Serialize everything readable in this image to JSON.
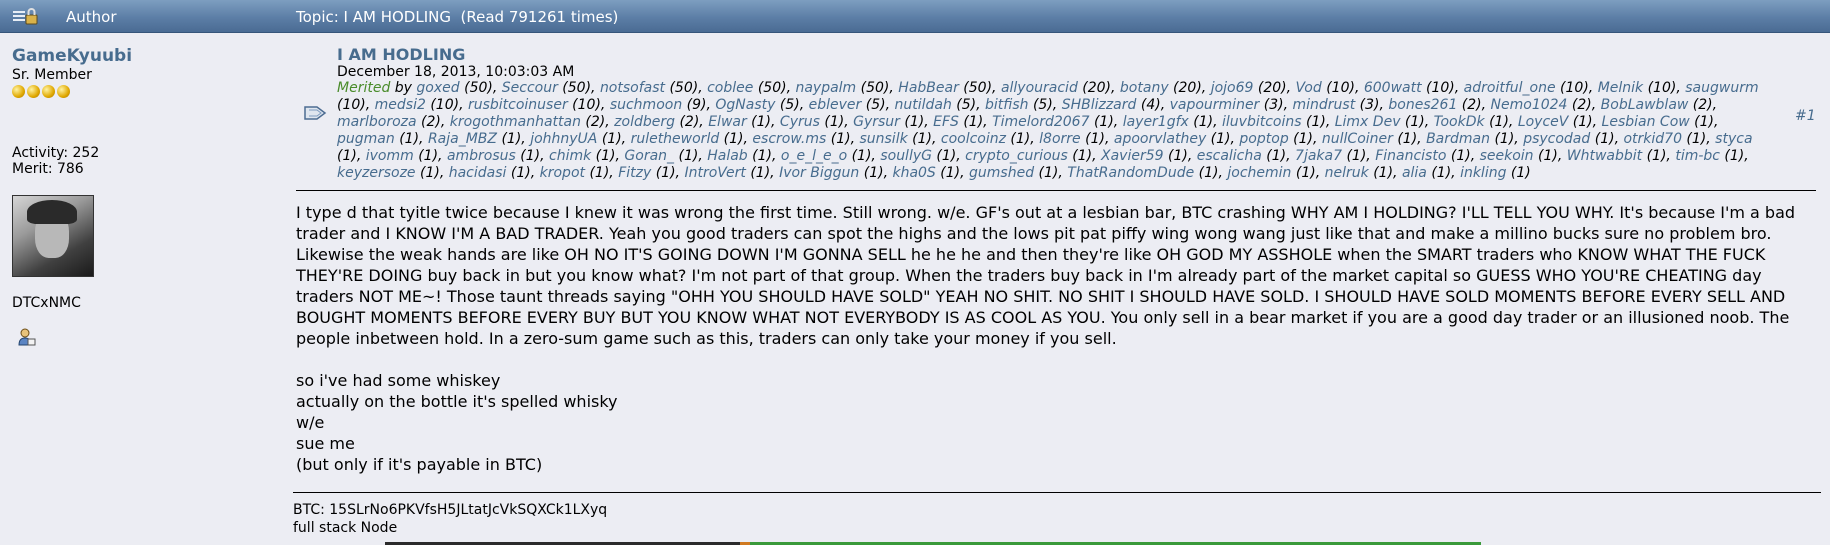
{
  "header": {
    "author_label": "Author",
    "topic_title": "Topic: I AM HODLING  (Read 791261 times)",
    "lock_icon": "lock-icon"
  },
  "poster": {
    "name": "GameKyuubi",
    "rank": "Sr. Member",
    "stars": 4,
    "activity": "Activity: 252",
    "merit": "Merit: 786",
    "sig_id": "DTCxNMC",
    "profile_icon": "profile-icon"
  },
  "post": {
    "subject": "I AM HODLING",
    "date": "December 18, 2013, 10:03:03 AM",
    "merited_label": "Merited",
    "by_label": " by ",
    "post_number": "#1",
    "merits": [
      {
        "user": "goxed",
        "count": "50"
      },
      {
        "user": "Seccour",
        "count": "50"
      },
      {
        "user": "notsofast",
        "count": "50"
      },
      {
        "user": "coblee",
        "count": "50"
      },
      {
        "user": "naypalm",
        "count": "50"
      },
      {
        "user": "HabBear",
        "count": "50"
      },
      {
        "user": "allyouracid",
        "count": "20"
      },
      {
        "user": "botany",
        "count": "20"
      },
      {
        "user": "jojo69",
        "count": "20"
      },
      {
        "user": "Vod",
        "count": "10"
      },
      {
        "user": "600watt",
        "count": "10"
      },
      {
        "user": "adroitful_one",
        "count": "10"
      },
      {
        "user": "Melnik",
        "count": "10"
      },
      {
        "user": "saugwurm",
        "count": "10"
      },
      {
        "user": "medsi2",
        "count": "10"
      },
      {
        "user": "rusbitcoinuser",
        "count": "10"
      },
      {
        "user": "suchmoon",
        "count": "9"
      },
      {
        "user": "OgNasty",
        "count": "5"
      },
      {
        "user": "eblever",
        "count": "5"
      },
      {
        "user": "nutildah",
        "count": "5"
      },
      {
        "user": "bitfish",
        "count": "5"
      },
      {
        "user": "SHBlizzard",
        "count": "4"
      },
      {
        "user": "vapourminer",
        "count": "3"
      },
      {
        "user": "mindrust",
        "count": "3"
      },
      {
        "user": "bones261",
        "count": "2"
      },
      {
        "user": "Nemo1024",
        "count": "2"
      },
      {
        "user": "BobLawblaw",
        "count": "2"
      },
      {
        "user": "marlboroza",
        "count": "2"
      },
      {
        "user": "krogothmanhattan",
        "count": "2"
      },
      {
        "user": "zoldberg",
        "count": "2"
      },
      {
        "user": "Elwar",
        "count": "1"
      },
      {
        "user": "Cyrus",
        "count": "1"
      },
      {
        "user": "Gyrsur",
        "count": "1"
      },
      {
        "user": "EFS",
        "count": "1"
      },
      {
        "user": "Timelord2067",
        "count": "1"
      },
      {
        "user": "layer1gfx",
        "count": "1"
      },
      {
        "user": "iluvbitcoins",
        "count": "1"
      },
      {
        "user": "Limx Dev",
        "count": "1"
      },
      {
        "user": "TookDk",
        "count": "1"
      },
      {
        "user": "LoyceV",
        "count": "1"
      },
      {
        "user": "Lesbian Cow",
        "count": "1"
      },
      {
        "user": "pugman",
        "count": "1"
      },
      {
        "user": "Raja_MBZ",
        "count": "1"
      },
      {
        "user": "johhnyUA",
        "count": "1"
      },
      {
        "user": "ruletheworld",
        "count": "1"
      },
      {
        "user": "escrow.ms",
        "count": "1"
      },
      {
        "user": "sunsilk",
        "count": "1"
      },
      {
        "user": "coolcoinz",
        "count": "1"
      },
      {
        "user": "l8orre",
        "count": "1"
      },
      {
        "user": "apoorvlathey",
        "count": "1"
      },
      {
        "user": "poptop",
        "count": "1"
      },
      {
        "user": "nullCoiner",
        "count": "1"
      },
      {
        "user": "Bardman",
        "count": "1"
      },
      {
        "user": "psycodad",
        "count": "1"
      },
      {
        "user": "otrkid70",
        "count": "1"
      },
      {
        "user": "styca",
        "count": "1"
      },
      {
        "user": "ivomm",
        "count": "1"
      },
      {
        "user": "ambrosus",
        "count": "1"
      },
      {
        "user": "chimk",
        "count": "1"
      },
      {
        "user": "Goran_",
        "count": "1"
      },
      {
        "user": "Halab",
        "count": "1"
      },
      {
        "user": "o_e_l_e_o",
        "count": "1"
      },
      {
        "user": "soullyG",
        "count": "1"
      },
      {
        "user": "crypto_curious",
        "count": "1"
      },
      {
        "user": "Xavier59",
        "count": "1"
      },
      {
        "user": "escalicha",
        "count": "1"
      },
      {
        "user": "7jaka7",
        "count": "1"
      },
      {
        "user": "Financisto",
        "count": "1"
      },
      {
        "user": "seekoin",
        "count": "1"
      },
      {
        "user": "Whtwabbit",
        "count": "1"
      },
      {
        "user": "tim-bc",
        "count": "1"
      },
      {
        "user": "keyzersoze",
        "count": "1"
      },
      {
        "user": "hacidasi",
        "count": "1"
      },
      {
        "user": "kropot",
        "count": "1"
      },
      {
        "user": "Fitzy",
        "count": "1"
      },
      {
        "user": "IntroVert",
        "count": "1"
      },
      {
        "user": "Ivor Biggun",
        "count": "1"
      },
      {
        "user": "kha0S",
        "count": "1"
      },
      {
        "user": "gumshed",
        "count": "1"
      },
      {
        "user": "ThatRandomDude",
        "count": "1"
      },
      {
        "user": "jochemin",
        "count": "1"
      },
      {
        "user": "nelruk",
        "count": "1"
      },
      {
        "user": "alia",
        "count": "1"
      },
      {
        "user": "inkling",
        "count": "1"
      }
    ],
    "body_paragraph": "I type d that tyitle twice because I knew it was wrong the first time.  Still wrong.  w/e.  GF's out at a lesbian bar, BTC crashing WHY AM I HOLDING? I'LL TELL YOU WHY.  It's because I'm a bad trader and I KNOW I'M A BAD TRADER.  Yeah you good traders can spot the highs and the lows pit pat piffy wing wong wang just like that and make a millino bucks sure no problem bro.  Likewise the weak hands are like OH NO IT'S GOING DOWN I'M GONNA SELL he he he and then they're like OH GOD MY ASSHOLE when the SMART traders who KNOW WHAT THE FUCK THEY'RE DOING buy back in but you know what?  I'm not part of that group.  When the traders buy back in I'm already part of the market capital so GUESS WHO YOU'RE CHEATING day traders NOT ME~!  Those taunt threads saying \"OHH YOU SHOULD HAVE SOLD\" YEAH NO SHIT.  NO SHIT I SHOULD HAVE SOLD.  I SHOULD HAVE SOLD MOMENTS BEFORE EVERY SELL AND BOUGHT MOMENTS BEFORE EVERY BUY BUT YOU KNOW WHAT NOT EVERYBODY IS AS COOL AS YOU.  You only sell in a bear market if you are a good day trader or an illusioned noob.  The people inbetween hold.  In a zero-sum game such as this, traders can only take your money if you sell.",
    "body_lines": [
      "so i've had some whiskey",
      "actually on the bottle it's spelled whisky",
      "w/e",
      "sue me",
      "(but only if it's payable in BTC)"
    ],
    "message_icon": "message-icon"
  },
  "signature": {
    "btc": "BTC: 15SLrNo6PKVfsH5JLtatJcVkSQXCk1LXyq",
    "node": "full stack Node"
  }
}
